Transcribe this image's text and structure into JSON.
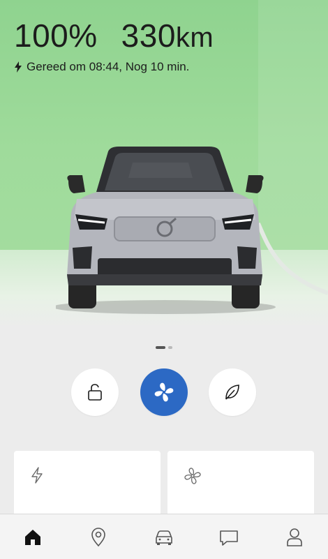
{
  "status": {
    "battery_percent": "100%",
    "range_value": "330",
    "range_unit": "km",
    "charge_message": "Gereed om 08:44, Nog 10 min."
  },
  "carousel": {
    "pages": 2,
    "active_page": 1
  },
  "quick_actions": [
    {
      "id": "lock",
      "icon": "lock-icon",
      "active": false
    },
    {
      "id": "climate",
      "icon": "fan-icon",
      "active": true
    },
    {
      "id": "eco",
      "icon": "leaf-icon",
      "active": false
    }
  ],
  "cards": [
    {
      "id": "charging",
      "icon": "bolt-icon"
    },
    {
      "id": "climate",
      "icon": "fan-icon"
    }
  ],
  "nav": [
    {
      "id": "home",
      "icon": "home-icon",
      "active": true
    },
    {
      "id": "map",
      "icon": "location-pin-icon",
      "active": false
    },
    {
      "id": "car",
      "icon": "car-icon",
      "active": false
    },
    {
      "id": "messages",
      "icon": "chat-icon",
      "active": false
    },
    {
      "id": "profile",
      "icon": "user-icon",
      "active": false
    }
  ],
  "colors": {
    "accent": "#2c69c4",
    "hero_background": "#9fdb9b",
    "page_background": "#ececec"
  }
}
